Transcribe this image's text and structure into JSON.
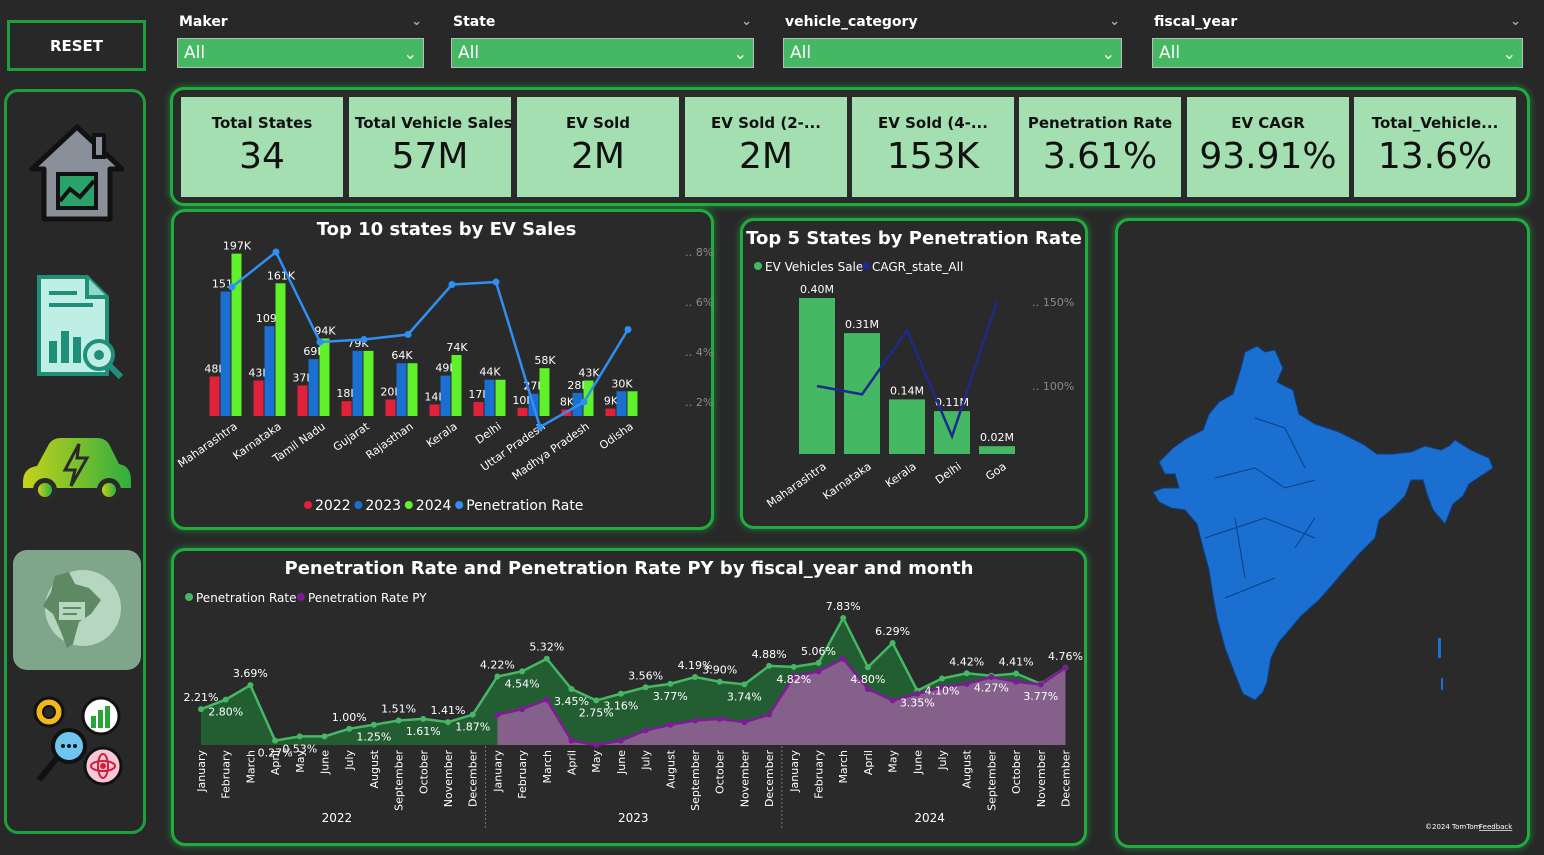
{
  "reset_label": "RESET",
  "slicers": [
    {
      "label": "Maker",
      "value": "All"
    },
    {
      "label": "State",
      "value": "All"
    },
    {
      "label": "vehicle_category",
      "value": "All"
    },
    {
      "label": "fiscal_year",
      "value": "All"
    }
  ],
  "nav": [
    "home-icon",
    "report-icon",
    "ev-car-icon",
    "map-icon",
    "insights-icon"
  ],
  "kpis": [
    {
      "title": "Total States",
      "value": "34"
    },
    {
      "title": "Total Vehicle Sales",
      "value": "57M"
    },
    {
      "title": "EV Sold",
      "value": "2M"
    },
    {
      "title": "EV Sold (2-...",
      "value": "2M"
    },
    {
      "title": "EV Sold (4-...",
      "value": "153K"
    },
    {
      "title": "Penetration Rate",
      "value": "3.61%"
    },
    {
      "title": "EV CAGR",
      "value": "93.91%"
    },
    {
      "title": "Total_Vehicle...",
      "value": "13.6%"
    }
  ],
  "colors": {
    "c2022": "#e0213a",
    "c2023": "#1a6fd1",
    "c2024": "#5ff22a",
    "pen": "#2f8ff2",
    "green": "#45b864",
    "cagr": "#1c2a8c",
    "purple": "#7e1b94"
  },
  "map": {
    "copyright": "©2024 TomTom",
    "feedback": "Feedback"
  },
  "chart_data": [
    {
      "type": "bar",
      "title": "Top 10 states by EV Sales",
      "categories": [
        "Maharashtra",
        "Karnataka",
        "Tamil Nadu",
        "Gujarat",
        "Rajasthan",
        "Kerala",
        "Delhi",
        "Uttar Pradesh",
        "Madhya Pradesh",
        "Odisha"
      ],
      "series": [
        {
          "name": "2022",
          "values": [
            48,
            43,
            37,
            18,
            20,
            14,
            17,
            10,
            8,
            9
          ],
          "labels": [
            "48K",
            "43K",
            "37K",
            "18K",
            "20K",
            "14K",
            "17K",
            "10K",
            "8K",
            "9K"
          ]
        },
        {
          "name": "2023",
          "values": [
            151,
            109,
            69,
            79,
            64,
            49,
            44,
            27,
            28,
            30
          ],
          "labels": [
            "151K",
            "109K",
            "69K",
            "79K",
            "64K",
            "49K",
            "44K",
            "27K",
            "28K",
            "30K"
          ]
        },
        {
          "name": "2024",
          "values": [
            197,
            161,
            94,
            79,
            64,
            74,
            44,
            58,
            43,
            30
          ],
          "labels": [
            "197K",
            "161K",
            "94K",
            "",
            "",
            "74K",
            "",
            "58K",
            "43K",
            ""
          ]
        }
      ],
      "line": {
        "name": "Penetration Rate",
        "values": [
          6.6,
          8.0,
          4.4,
          4.5,
          4.7,
          6.7,
          6.8,
          1.0,
          2.0,
          4.9
        ]
      },
      "y2_ticks": [
        "2%",
        "4%",
        "6%",
        "8%"
      ],
      "legend_position": "bottom"
    },
    {
      "type": "bar",
      "title": "Top 5 States by Penetration Rate",
      "categories": [
        "Maharashtra",
        "Karnataka",
        "Kerala",
        "Delhi",
        "Goa"
      ],
      "series": [
        {
          "name": "EV Vehicles Sale",
          "values": [
            0.4,
            0.31,
            0.14,
            0.11,
            0.02
          ],
          "labels": [
            "0.40M",
            "0.31M",
            "0.14M",
            "0.11M",
            "0.02M"
          ]
        }
      ],
      "line": {
        "name": "CAGR_state_All",
        "values": [
          100,
          95,
          133,
          70,
          150
        ]
      },
      "y2_ticks": [
        "100%",
        "150%"
      ],
      "legend_position": "top-left"
    },
    {
      "type": "area",
      "title": "Penetration Rate and Penetration Rate PY by fiscal_year and month",
      "months": [
        "January",
        "February",
        "March",
        "April",
        "May",
        "June",
        "July",
        "August",
        "September",
        "October",
        "November",
        "December"
      ],
      "years": [
        "2022",
        "2023",
        "2024"
      ],
      "series": [
        {
          "name": "Penetration Rate",
          "values": [
            2.21,
            2.8,
            3.69,
            0.27,
            0.53,
            0.53,
            1.0,
            1.25,
            1.51,
            1.61,
            1.41,
            1.87,
            4.22,
            4.54,
            5.32,
            3.45,
            2.75,
            3.16,
            3.56,
            3.77,
            4.19,
            3.9,
            3.74,
            4.88,
            4.82,
            5.06,
            7.83,
            4.8,
            6.29,
            3.35,
            4.1,
            4.42,
            4.27,
            4.41,
            3.77,
            4.76
          ],
          "labels": [
            "2.21%",
            "2.80%",
            "3.69%",
            "0.27%",
            "0.53%",
            "",
            "1.00%",
            "1.25%",
            "1.51%",
            "1.61%",
            "1.41%",
            "1.87%",
            "4.22%",
            "4.54%",
            "5.32%",
            "3.45%",
            "2.75%",
            "3.16%",
            "3.56%",
            "3.77%",
            "4.19%",
            "3.90%",
            "3.74%",
            "4.88%",
            "4.82%",
            "5.06%",
            "7.83%",
            "4.80%",
            "6.29%",
            "3.35%",
            "4.10%",
            "4.42%",
            "4.27%",
            "4.41%",
            "3.77%",
            "4.76%"
          ]
        },
        {
          "name": "Penetration Rate PY",
          "values": [
            null,
            null,
            null,
            null,
            null,
            null,
            null,
            null,
            null,
            null,
            null,
            null,
            1.87,
            2.21,
            2.8,
            0.27,
            0.0,
            0.27,
            0.9,
            1.25,
            1.51,
            1.61,
            1.41,
            1.87,
            4.22,
            4.54,
            5.32,
            3.45,
            2.75,
            3.16,
            3.56,
            3.77,
            4.19,
            3.9,
            3.74,
            4.76
          ]
        }
      ],
      "legend_position": "top-left"
    }
  ]
}
